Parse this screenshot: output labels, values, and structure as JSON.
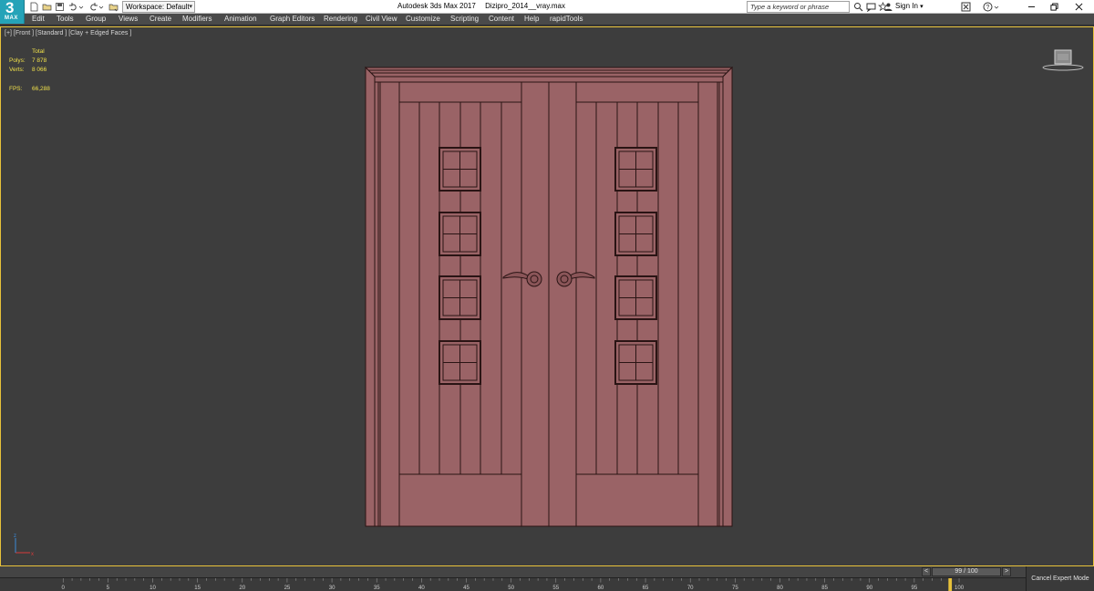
{
  "app": {
    "logo_text": "3",
    "logo_sub": "MAX",
    "title": "Autodesk 3ds Max 2017",
    "file_name": "Dizipro_2014__vray.max",
    "workspace_label": "Workspace: Default",
    "search_placeholder": "Type a keyword or phrase",
    "sign_in": "Sign In"
  },
  "menu": [
    "Edit",
    "Tools",
    "Group",
    "Views",
    "Create",
    "Modifiers",
    "Animation",
    "Graph Editors",
    "Rendering",
    "Civil View",
    "Customize",
    "Scripting",
    "Content",
    "Help",
    "rapidTools"
  ],
  "viewport": {
    "label": "[+] [Front ] [Standard ] [Clay + Edged Faces ]",
    "stats": {
      "total_label": "Total",
      "polys_label": "Polys:",
      "polys_value": "7 878",
      "verts_label": "Verts:",
      "verts_value": "8 066",
      "fps_label": "FPS:",
      "fps_value": "66,288"
    }
  },
  "timeline": {
    "frame_display": "99 / 100",
    "current_frame": 99,
    "ticks": [
      "0",
      "5",
      "10",
      "15",
      "20",
      "25",
      "30",
      "35",
      "40",
      "45",
      "50",
      "55",
      "60",
      "65",
      "70",
      "75",
      "80",
      "85",
      "90",
      "95",
      "100"
    ],
    "cancel_expert_mode": "Cancel Expert Mode"
  },
  "colors": {
    "door_fill": "#9a6366",
    "door_line": "#2a1414",
    "viewport_bg": "#3d3d3d",
    "active_border": "#e8c23a",
    "stats_text": "#f0e04a"
  }
}
